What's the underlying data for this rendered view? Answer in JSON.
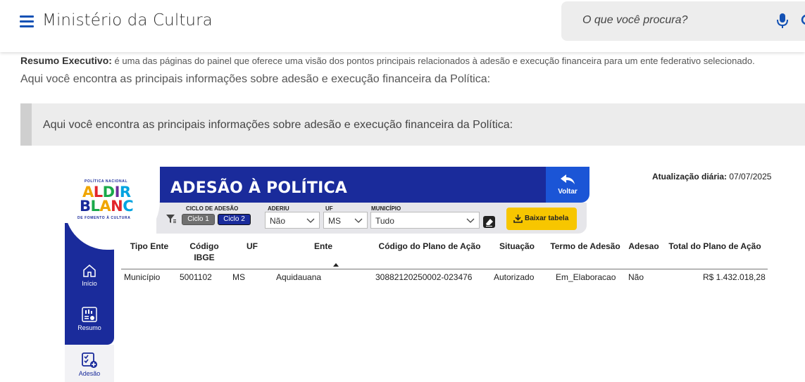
{
  "header": {
    "site_title": "Ministério da Cultura",
    "search_placeholder": "O que você procura?"
  },
  "content": {
    "intro_bold": "Resumo Executivo:",
    "intro_text": " é uma das páginas do painel que oferece uma visão dos pontos principais relacionados à adesão e execução financeira para um ente federativo selecionado.",
    "intro_line2": "Aqui você encontra as principais informações sobre adesão e execução financeira da Política:",
    "callout": "Aqui você encontra as principais informações sobre adesão e execução financeira da Política:"
  },
  "dashboard": {
    "logo": {
      "top": "POLÍTICA NACIONAL",
      "line1": "ALDIR",
      "line2": "BLANC",
      "bottom": "DE FOMENTO À CULTURA"
    },
    "title": "ADESÃO À POLÍTICA",
    "back_label": "Voltar",
    "update_label": "Atualização diária:",
    "update_date": "07/07/2025",
    "filters": {
      "ciclo_label": "CICLO DE ADESÃO",
      "ciclo1": "Ciclo 1",
      "ciclo2": "Ciclo 2",
      "aderiu_label": "ADERIU",
      "aderiu_value": "Não",
      "uf_label": "UF",
      "uf_value": "MS",
      "municipio_label": "MUNICÍPIO",
      "municipio_value": "Tudo"
    },
    "download_label": "Baixar tabela",
    "nav": [
      {
        "label": "Início"
      },
      {
        "label": "Resumo"
      },
      {
        "label": "Adesão"
      }
    ],
    "table": {
      "columns": [
        "Tipo Ente",
        "Código IBGE",
        "UF",
        "Ente",
        "Código do Plano de Ação",
        "Situação",
        "Termo de Adesão",
        "Adesao",
        "Total do Plano de Ação"
      ],
      "rows": [
        [
          "Município",
          "5001102",
          "MS",
          "Aquidauana",
          "30882120250002-023476",
          "Autorizado",
          "Em_Elaboracao",
          "Não",
          "R$ 1.432.018,28"
        ]
      ]
    }
  },
  "colors": {
    "dash_blue": "#1a2b9b",
    "voltar_blue": "#1b55d6",
    "download_yellow": "#f7c600",
    "gov_blue": "#1351b4"
  }
}
